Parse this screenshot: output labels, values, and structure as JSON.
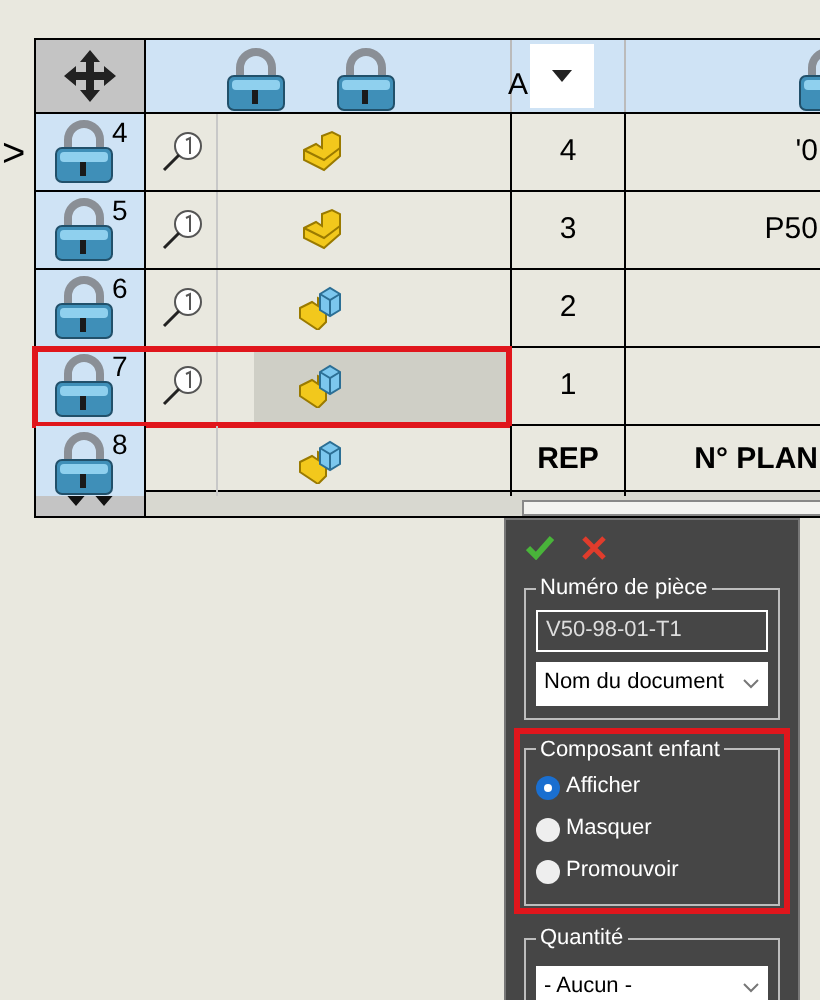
{
  "table": {
    "header": {
      "column_3": "A"
    },
    "rows": [
      {
        "number": "4",
        "kind": "part",
        "magnifier": true,
        "rep": "4",
        "column_5": "'0",
        "selected": false,
        "highlighted": false,
        "marker": ">"
      },
      {
        "number": "5",
        "kind": "part",
        "magnifier": true,
        "rep": "3",
        "column_5": "P50",
        "selected": false,
        "highlighted": false
      },
      {
        "number": "6",
        "kind": "assembly",
        "magnifier": true,
        "rep": "2",
        "column_5": "",
        "selected": false,
        "highlighted": false
      },
      {
        "number": "7",
        "kind": "assembly",
        "magnifier": true,
        "rep": "1",
        "column_5": "",
        "selected": true,
        "highlighted": true
      },
      {
        "number": "8",
        "kind": "assembly",
        "magnifier": false,
        "rep": "REP",
        "column_5": "N° PLAN",
        "selected": false,
        "highlighted": false,
        "bold": true
      }
    ]
  },
  "panel": {
    "part_number": {
      "title": "Numéro de pièce",
      "value": "V50-98-01-T1",
      "source": "Nom du document"
    },
    "child_component": {
      "title": "Composant enfant",
      "highlighted": true,
      "options": [
        {
          "label": "Afficher",
          "selected": true
        },
        {
          "label": "Masquer",
          "selected": false
        },
        {
          "label": "Promouvoir",
          "selected": false
        }
      ]
    },
    "quantity": {
      "title": "Quantité",
      "value": "- Aucun -"
    }
  }
}
